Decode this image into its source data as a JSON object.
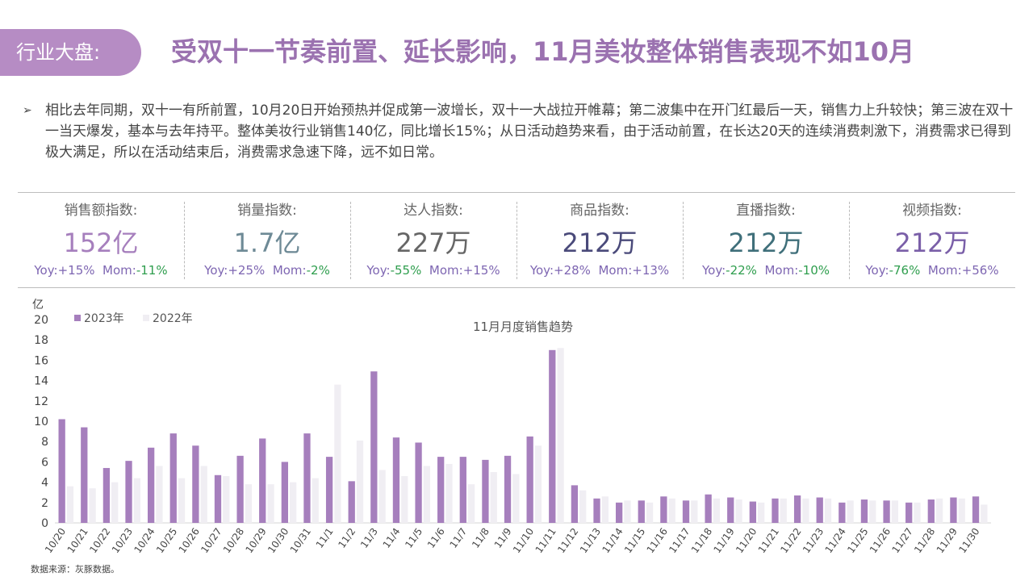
{
  "header": {
    "tag": "行业大盘:",
    "title": "受双十一节奏前置、延长影响，11月美妆整体销售表现不如10月"
  },
  "summary": "相比去年同期，双十一有所前置，10月20日开始预热并促成第一波增长，双十一大战拉开帷幕；第二波集中在开门红最后一天，销售力上升较快；第三波在双十一当天爆发，基本与去年持平。整体美妆行业销售140亿，同比增长15%；从日活动趋势来看，由于活动前置，在长达20天的连续消费刺激下，消费需求已得到极大满足，所以在活动结束后，消费需求急速下降，远不如日常。",
  "kpis": [
    {
      "label": "销售额指数:",
      "value": "152亿",
      "color": "#a67fbd",
      "yoy": "+15%",
      "yoy_dir": "up",
      "mom": "-11%",
      "mom_dir": "down"
    },
    {
      "label": "销量指数:",
      "value": "1.7亿",
      "color": "#6e8a96",
      "yoy": "+25%",
      "yoy_dir": "up",
      "mom": "-2%",
      "mom_dir": "down"
    },
    {
      "label": "达人指数:",
      "value": "227万",
      "color": "#666666",
      "yoy": "-55%",
      "yoy_dir": "down",
      "mom": "+15%",
      "mom_dir": "up"
    },
    {
      "label": "商品指数:",
      "value": "212万",
      "color": "#4a4a7a",
      "yoy": "+28%",
      "yoy_dir": "up",
      "mom": "+13%",
      "mom_dir": "up"
    },
    {
      "label": "直播指数:",
      "value": "212万",
      "color": "#3f6f7a",
      "yoy": "-22%",
      "yoy_dir": "down",
      "mom": "-10%",
      "mom_dir": "down"
    },
    {
      "label": "视频指数:",
      "value": "212万",
      "color": "#7a5fa8",
      "yoy": "-76%",
      "yoy_dir": "down",
      "mom": "+56%",
      "mom_dir": "up"
    }
  ],
  "kpi_prefix": {
    "yoy": "Yoy:",
    "mom": "Mom:"
  },
  "chart_data": {
    "type": "bar",
    "title": "11月月度销售趋势",
    "ylabel": "亿",
    "ylim": [
      0,
      20
    ],
    "yticks": [
      0,
      2,
      4,
      6,
      8,
      10,
      12,
      14,
      16,
      18,
      20
    ],
    "categories": [
      "10/20",
      "10/21",
      "10/22",
      "10/23",
      "10/24",
      "10/25",
      "10/26",
      "10/27",
      "10/28",
      "10/29",
      "10/30",
      "10/31",
      "11/1",
      "11/2",
      "11/3",
      "11/4",
      "11/5",
      "11/6",
      "11/7",
      "11/8",
      "11/9",
      "11/10",
      "11/11",
      "11/12",
      "11/13",
      "11/14",
      "11/15",
      "11/16",
      "11/17",
      "11/18",
      "11/19",
      "11/20",
      "11/21",
      "11/22",
      "11/23",
      "11/24",
      "11/25",
      "11/26",
      "11/27",
      "11/28",
      "11/29",
      "11/30"
    ],
    "series": [
      {
        "name": "2023年",
        "color": "#a67fbd",
        "values": [
          10.2,
          9.4,
          5.4,
          6.1,
          7.4,
          8.8,
          7.6,
          4.7,
          6.6,
          8.3,
          6.0,
          8.8,
          6.5,
          4.1,
          14.9,
          8.4,
          7.9,
          6.5,
          6.5,
          6.2,
          6.6,
          8.5,
          17.0,
          3.7,
          2.4,
          2.0,
          2.2,
          2.6,
          2.2,
          2.8,
          2.5,
          2.1,
          2.4,
          2.7,
          2.5,
          2.0,
          2.3,
          2.2,
          2.0,
          2.3,
          2.5,
          2.6
        ]
      },
      {
        "name": "2022年",
        "color": "#f0eef3",
        "values": [
          3.6,
          3.4,
          4.0,
          4.4,
          5.6,
          4.4,
          5.6,
          4.6,
          3.8,
          3.8,
          4.0,
          4.4,
          13.6,
          8.1,
          5.2,
          4.6,
          5.6,
          5.8,
          3.8,
          5.0,
          4.8,
          7.6,
          17.2,
          3.2,
          2.6,
          2.2,
          2.0,
          2.4,
          2.2,
          2.4,
          2.3,
          2.0,
          2.4,
          2.4,
          2.4,
          2.2,
          2.2,
          2.2,
          2.0,
          2.4,
          2.4,
          1.8
        ]
      }
    ],
    "legend_position": "top-left",
    "grid": false
  },
  "source": "数据来源：灰豚数据。"
}
